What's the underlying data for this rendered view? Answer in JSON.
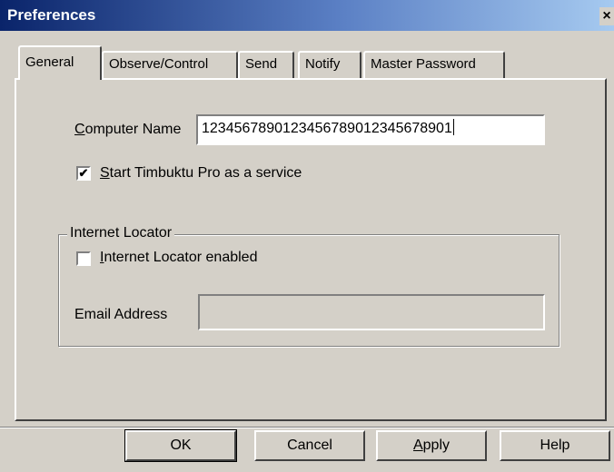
{
  "window": {
    "title": "Preferences",
    "close_glyph": "×"
  },
  "tabs": [
    {
      "label": "General",
      "active": true
    },
    {
      "label": "Observe/Control",
      "active": false
    },
    {
      "label": "Send",
      "active": false
    },
    {
      "label": "Notify",
      "active": false
    },
    {
      "label": "Master Password",
      "active": false
    }
  ],
  "general": {
    "computer_name": {
      "label_first": "C",
      "label_rest": "omputer Name",
      "value": "1234567890123456789012345678901"
    },
    "service": {
      "label_first": "S",
      "label_rest": "tart Timbuktu Pro as a service",
      "checked": true,
      "check_glyph": "✔"
    },
    "internet_locator": {
      "group_title": "Internet Locator",
      "enabled": {
        "label_first": "I",
        "label_rest": "nternet Locator enabled",
        "checked": false
      },
      "email": {
        "label": "Email Address",
        "value": ""
      }
    }
  },
  "buttons": {
    "ok": "OK",
    "cancel": "Cancel",
    "apply_first": "A",
    "apply_rest": "pply",
    "help": "Help"
  }
}
